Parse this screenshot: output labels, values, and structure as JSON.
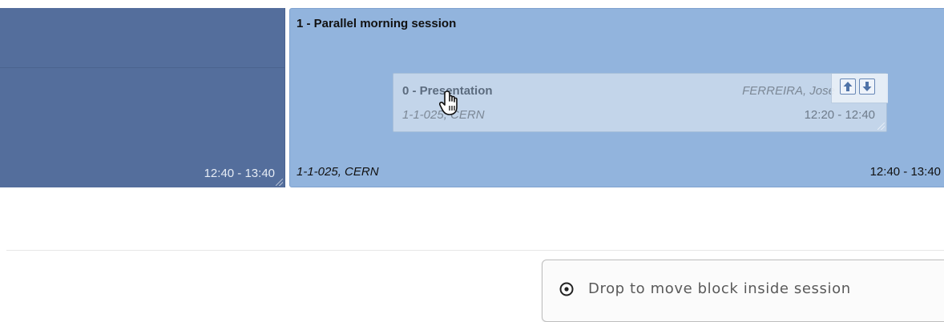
{
  "previous_block": {
    "time": "12:40 - 13:40"
  },
  "session": {
    "title": "1 - Parallel morning session",
    "location": "1-1-025, CERN",
    "time": "12:40 - 13:40",
    "color": "#92b4dd"
  },
  "presentation": {
    "title": "0 - Presentation",
    "speaker": "FERREIRA, Jose",
    "location": "1-1-025, CERN",
    "time": "12:20 - 12:40"
  },
  "icons": {
    "move_up": "arrow-up-icon",
    "move_down": "arrow-down-icon",
    "cursor": "hand-pointer-icon",
    "drop": "target-icon"
  },
  "drop_hint": {
    "text": "Drop to move block inside session"
  }
}
